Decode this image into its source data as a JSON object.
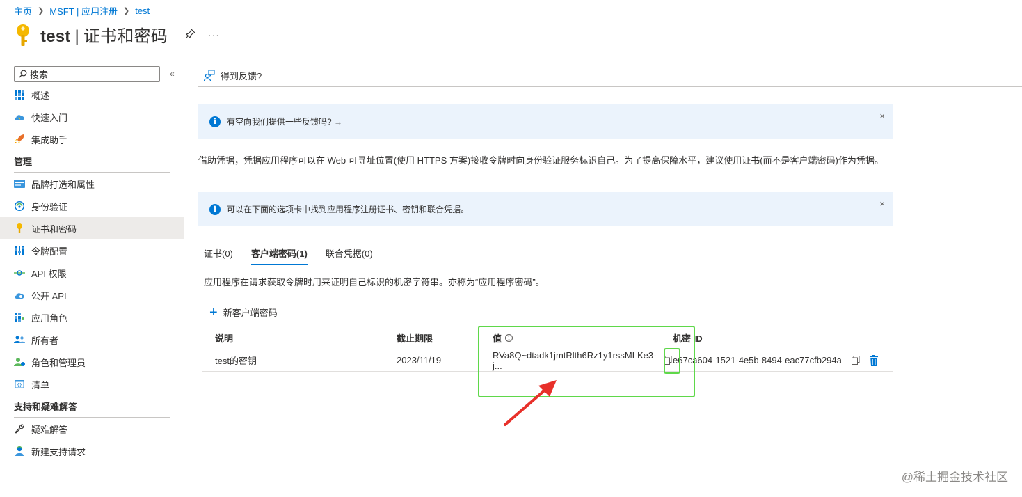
{
  "breadcrumb": {
    "home": "主页",
    "app": "MSFT | 应用注册",
    "current": "test"
  },
  "header": {
    "name": "test",
    "pipe": "|",
    "section": "证书和密码",
    "more": "···"
  },
  "sidebar": {
    "search_placeholder": "搜索",
    "collapse": "«",
    "top_items": [
      {
        "label": "概述",
        "icon": "grid-icon"
      },
      {
        "label": "快速入门",
        "icon": "cloud-lightning-icon"
      },
      {
        "label": "集成助手",
        "icon": "rocket-icon"
      }
    ],
    "manage_title": "管理",
    "manage_items": [
      {
        "label": "品牌打造和属性",
        "icon": "branding-icon"
      },
      {
        "label": "身份验证",
        "icon": "authentication-icon"
      },
      {
        "label": "证书和密码",
        "icon": "key-icon",
        "active": true
      },
      {
        "label": "令牌配置",
        "icon": "token-bars-icon"
      },
      {
        "label": "API 权限",
        "icon": "api-permission-icon"
      },
      {
        "label": "公开 API",
        "icon": "cloud-api-icon"
      },
      {
        "label": "应用角色",
        "icon": "app-roles-icon"
      },
      {
        "label": "所有者",
        "icon": "owners-icon"
      },
      {
        "label": "角色和管理员",
        "icon": "roles-admins-icon"
      },
      {
        "label": "清单",
        "icon": "manifest-icon"
      }
    ],
    "support_title": "支持和疑难解答",
    "support_items": [
      {
        "label": "疑难解答",
        "icon": "wrench-icon"
      },
      {
        "label": "新建支持请求",
        "icon": "support-person-icon"
      }
    ]
  },
  "cmdbar": {
    "feedback": "得到反馈?"
  },
  "banners": {
    "feedback": "有空向我们提供一些反馈吗? →",
    "tabs_hint": "可以在下面的选项卡中找到应用程序注册证书、密钥和联合凭据。",
    "close": "×"
  },
  "description": "借助凭据，凭据应用程序可以在 Web 可寻址位置(使用 HTTPS 方案)接收令牌时向身份验证服务标识自己。为了提高保障水平，建议使用证书(而不是客户端密码)作为凭据。",
  "tabs": [
    {
      "label": "证书(0)",
      "active": false
    },
    {
      "label": "客户端密码(1)",
      "active": true
    },
    {
      "label": "联合凭据(0)",
      "active": false
    }
  ],
  "tab_description": "应用程序在请求获取令牌时用来证明自己标识的机密字符串。亦称为“应用程序密码”。",
  "new_secret": {
    "plus": "+",
    "label": "新客户端密码"
  },
  "table": {
    "headers": {
      "description": "说明",
      "expires": "截止期限",
      "value": "值",
      "value_info": "i",
      "secret_id": "机密 ID"
    },
    "rows": [
      {
        "description": "test的密钥",
        "expires": "2023/11/19",
        "value": "RVa8Q~dtadk1jmtRlth6Rz1y1rssMLKe3-j...",
        "secret_id": "e67ca604-1521-4e5b-8494-eac77cfb294a"
      }
    ]
  },
  "watermark": "@稀土掘金技术社区",
  "colors": {
    "accent": "#0078d4",
    "highlight": "#5fd84a",
    "arrow": "#e8302a",
    "info_bg": "#ebf3fc"
  }
}
